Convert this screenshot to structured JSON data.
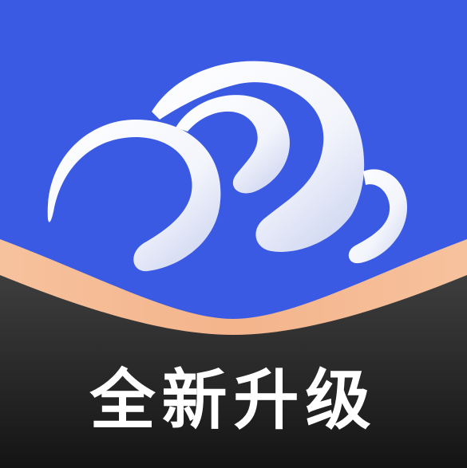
{
  "icon": {
    "name": "cloud-logo-icon",
    "colors": {
      "background": "#3a5ae4",
      "peach_band": "#f4b48c",
      "dark_band_top": "#3b3b3b",
      "dark_band_bottom": "#111111",
      "cloud_white": "#ffffff",
      "cloud_shadow": "#c9d1ec",
      "text": "#ffffff"
    }
  },
  "banner": {
    "label": "全新升级"
  }
}
